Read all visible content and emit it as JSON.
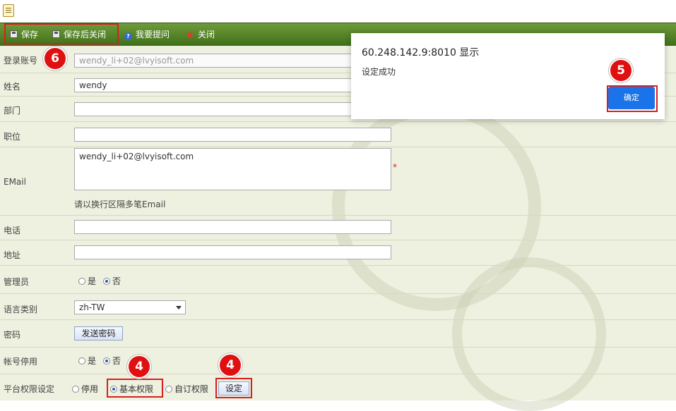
{
  "toolbar": {
    "save": "保存",
    "save_close": "保存后关闭",
    "help": "我要提问",
    "close": "关闭"
  },
  "dialog": {
    "title": "60.248.142.9:8010 显示",
    "message": "设定成功",
    "ok": "确定"
  },
  "form": {
    "account_label": "登录账号",
    "account_value": "wendy_li+02@lvyisoft.com",
    "name_label": "姓名",
    "name_value": "wendy",
    "dept_label": "部门",
    "dept_value": "",
    "position_label": "职位",
    "position_value": "",
    "email_label": "EMail",
    "email_value": "wendy_li+02@lvyisoft.com",
    "email_hint": "请以换行区隔多笔Email",
    "required_mark": "*",
    "phone_label": "电话",
    "phone_value": "",
    "address_label": "地址",
    "address_value": "",
    "admin_label": "管理员",
    "admin_yes": "是",
    "admin_no": "否",
    "lang_label": "语言类别",
    "lang_value": "zh-TW",
    "password_label": "密码",
    "send_password": "发送密码",
    "disabled_label": "帐号停用",
    "disabled_yes": "是",
    "disabled_no": "否",
    "platform_label": "平台权限设定",
    "platform_off": "停用",
    "platform_basic": "基本权限",
    "platform_custom": "自订权限",
    "platform_set": "设定"
  },
  "badges": {
    "b6": "6",
    "b5": "5",
    "b4a": "4",
    "b4b": "4"
  },
  "colors": {
    "toolbar": "#4f7f25",
    "highlight": "#d62020",
    "badge": "#e01010",
    "ok_button": "#1a73e8"
  }
}
